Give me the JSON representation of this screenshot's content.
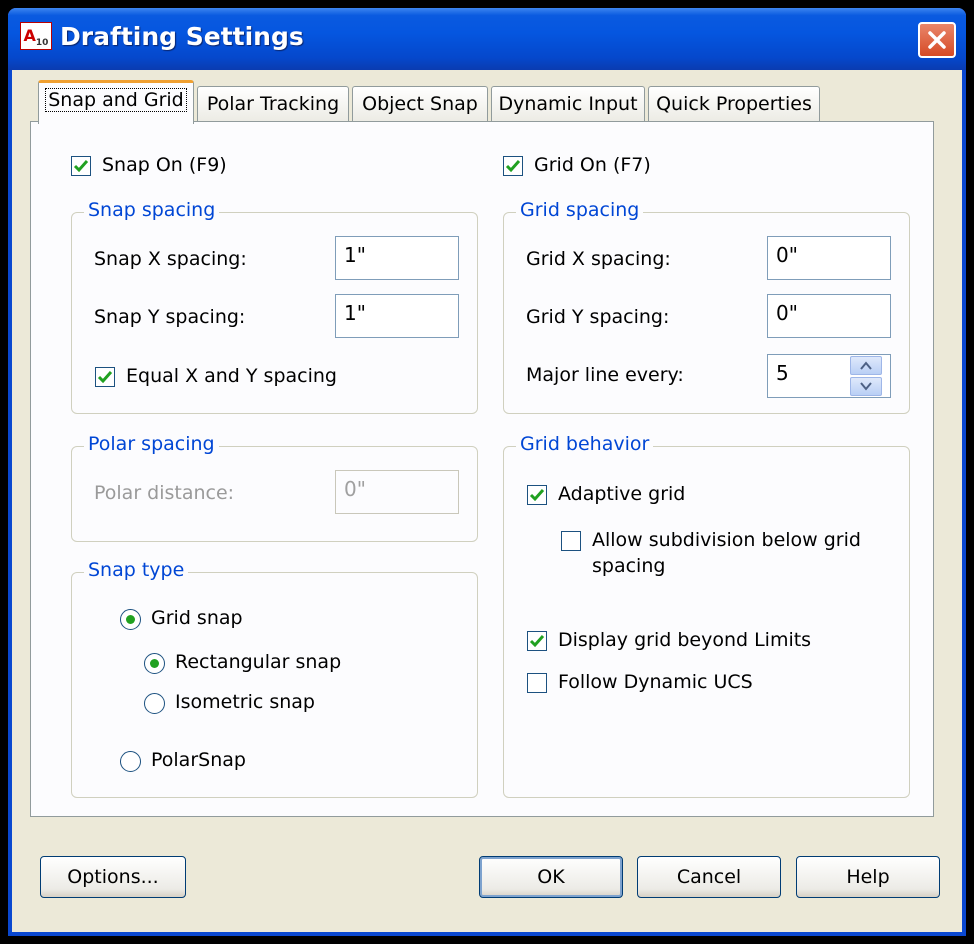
{
  "window": {
    "title": "Drafting Settings",
    "icon_text": "A",
    "icon_sub": "10"
  },
  "tabs": [
    "Snap and Grid",
    "Polar Tracking",
    "Object Snap",
    "Dynamic Input",
    "Quick Properties"
  ],
  "snap": {
    "snap_on_label": "Snap On (F9)",
    "snap_on_checked": true,
    "spacing_title": "Snap spacing",
    "x_label": "Snap X spacing:",
    "x_value": "1\"",
    "y_label": "Snap Y spacing:",
    "y_value": "1\"",
    "equal_label": "Equal X and Y spacing",
    "equal_checked": true,
    "polar_title": "Polar spacing",
    "polar_label": "Polar distance:",
    "polar_value": "0\"",
    "type_title": "Snap type",
    "grid_snap_label": "Grid snap",
    "rect_snap_label": "Rectangular snap",
    "iso_snap_label": "Isometric snap",
    "polarsnap_label": "PolarSnap"
  },
  "grid": {
    "grid_on_label": "Grid On (F7)",
    "grid_on_checked": true,
    "spacing_title": "Grid spacing",
    "x_label": "Grid X spacing:",
    "x_value": "0\"",
    "y_label": "Grid Y spacing:",
    "y_value": "0\"",
    "major_label": "Major line every:",
    "major_value": "5",
    "behavior_title": "Grid behavior",
    "adaptive_label": "Adaptive grid",
    "adaptive_checked": true,
    "subdivision_label_1": "Allow subdivision below grid",
    "subdivision_label_2": "spacing",
    "subdivision_checked": false,
    "beyond_label": "Display grid beyond Limits",
    "beyond_checked": true,
    "dynamic_ucs_label": "Follow Dynamic UCS",
    "dynamic_ucs_checked": false
  },
  "buttons": {
    "options": "Options...",
    "ok": "OK",
    "cancel": "Cancel",
    "help": "Help"
  },
  "colors": {
    "title_bar": "#0556e0",
    "group_title": "#0046d5",
    "check_mark": "#21a121",
    "tab_highlight": "#f0a030"
  }
}
